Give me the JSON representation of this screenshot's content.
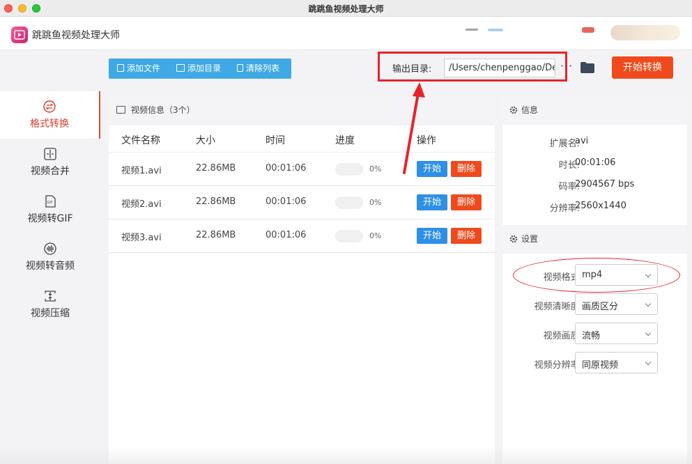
{
  "window": {
    "title": "跳跳鱼视频处理大师"
  },
  "app": {
    "name": "跳跳鱼视频处理大师"
  },
  "sidebar": {
    "items": [
      {
        "label": "格式转换",
        "icon": "convert-icon",
        "active": true
      },
      {
        "label": "视频合并",
        "icon": "merge-icon",
        "active": false
      },
      {
        "label": "视频转GIF",
        "icon": "gif-icon",
        "active": false
      },
      {
        "label": "视频转音频",
        "icon": "audio-icon",
        "active": false
      },
      {
        "label": "视频压缩",
        "icon": "compress-icon",
        "active": false
      }
    ]
  },
  "toolbar": {
    "add_file": "添加文件",
    "add_dir": "添加目录",
    "clear_list": "清除列表",
    "output_label": "输出目录:",
    "output_path": "/Users/chenpenggao/Desktop",
    "more": "···",
    "start_all": "开始转换"
  },
  "video_list": {
    "header": "视频信息（3个）",
    "columns": [
      "文件名称",
      "大小",
      "时间",
      "进度",
      "操作"
    ],
    "rows": [
      {
        "name": "视频1.avi",
        "size": "22.86MB",
        "time": "00:01:06",
        "progress": "0%"
      },
      {
        "name": "视频2.avi",
        "size": "22.86MB",
        "time": "00:01:06",
        "progress": "0%"
      },
      {
        "name": "视频3.avi",
        "size": "22.86MB",
        "time": "00:01:06",
        "progress": "0%"
      }
    ],
    "start_label": "开始",
    "delete_label": "删除"
  },
  "info": {
    "header": "信息",
    "ext_label": "扩展名:",
    "ext": "avi",
    "duration_label": "时长:",
    "duration": "00:01:06",
    "bitrate_label": "码率:",
    "bitrate": "2904567 bps",
    "resolution_label": "分辨率:",
    "resolution": "2560x1440"
  },
  "settings": {
    "header": "设置",
    "format_label": "视频格式:",
    "format": "mp4",
    "clarity_label": "视频清晰度:",
    "clarity": "画质区分",
    "quality_label": "视频画质:",
    "quality": "流畅",
    "res_label": "视频分辨率:",
    "res": "同原视频"
  },
  "colors": {
    "accent": "#f04a1c",
    "primary": "#2e8fe6",
    "toolbar": "#3fa9e6",
    "highlight": "#e8232a"
  }
}
